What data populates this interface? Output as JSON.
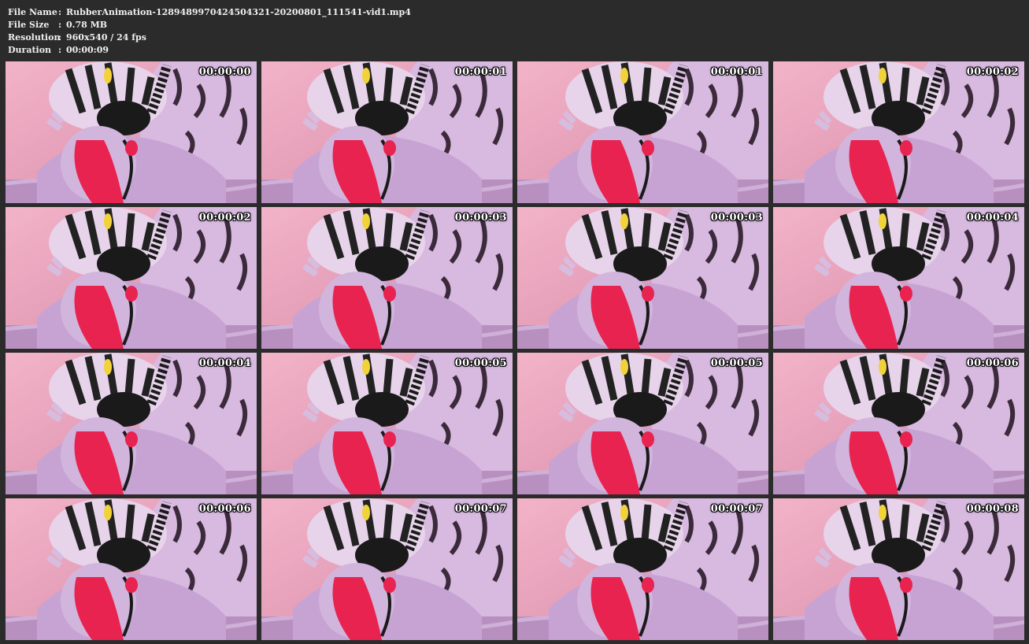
{
  "meta": [
    {
      "label": "File Name",
      "value": "RubberAnimation-1289489970424504321-20200801_111541-vid1.mp4"
    },
    {
      "label": "File Size",
      "value": "0.78 MB"
    },
    {
      "label": "Resolution",
      "value": "960x540 / 24 fps"
    },
    {
      "label": "Duration",
      "value": "00:00:09"
    }
  ],
  "separator": ":",
  "frames": [
    "00:00:00",
    "00:00:01",
    "00:00:01",
    "00:00:02",
    "00:00:02",
    "00:00:03",
    "00:00:03",
    "00:00:04",
    "00:00:04",
    "00:00:05",
    "00:00:05",
    "00:00:06",
    "00:00:06",
    "00:00:07",
    "00:00:07",
    "00:00:08"
  ],
  "colors": {
    "background": "#2b2b2b",
    "wall": "#e6a8c0",
    "lavender": "#c9a6d6",
    "red": "#e8234f",
    "black": "#1a1a1a"
  }
}
